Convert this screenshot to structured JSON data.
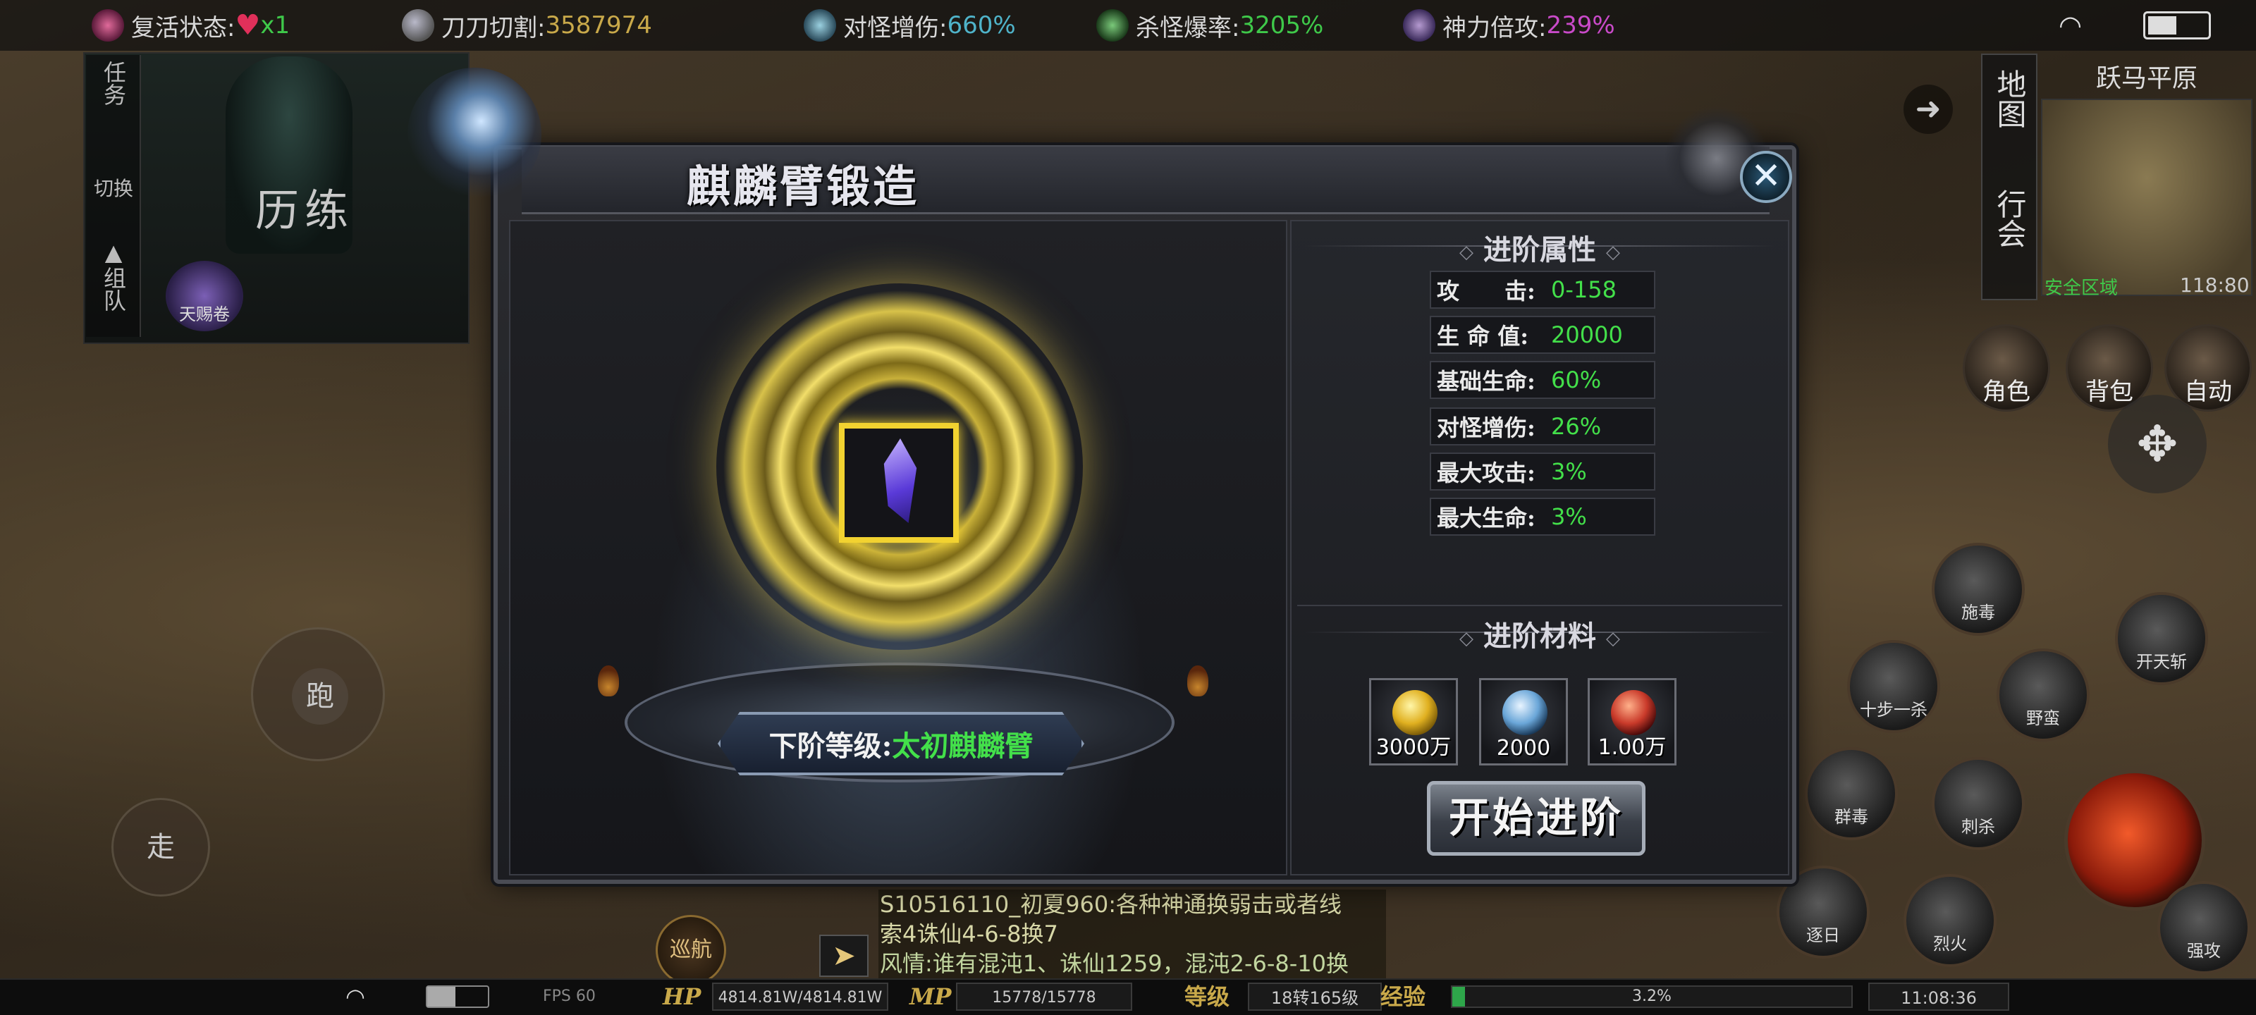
{
  "status_bar": {
    "revive": {
      "label": "复活状态:",
      "value": "x1",
      "color": "#3fc94a"
    },
    "cut": {
      "label": "刀刀切割:",
      "value": "3587974",
      "color": "#c9a94a"
    },
    "monster_damage": {
      "label": "对怪增伤:",
      "value": "660%",
      "color": "#4fb3c9"
    },
    "drop_rate": {
      "label": "杀怪爆率:",
      "value": "3205%",
      "color": "#3fc94a"
    },
    "divine_power": {
      "label": "神力倍攻:",
      "value": "239%",
      "color": "#c94ac9"
    }
  },
  "left_panel": {
    "tabs": [
      "任务",
      "切换",
      "组队"
    ],
    "title": "历练",
    "skill_label": "天赐卷"
  },
  "minimap": {
    "location": "跃马平原",
    "tabs": [
      "地图",
      "行会"
    ],
    "safe_zone": "安全区域",
    "coords": "118:80"
  },
  "right_buttons": {
    "character": "角色",
    "bag": "背包",
    "auto": "自动"
  },
  "skills": {
    "s1": "施毒",
    "s2": "开天斩",
    "s3": "十步一杀",
    "s4": "野蛮",
    "s5": "群毒",
    "s6": "刺杀",
    "s7": "逐日",
    "s8": "烈火",
    "s9": "强攻"
  },
  "joystick": {
    "run": "跑",
    "walk": "走"
  },
  "chat": {
    "lines": [
      "S10516110_初夏960:各种神通换弱击或者线",
      "索4诛仙4-6-8换7",
      "风情:谁有混沌1、诛仙1259，混沌2-6-8-10换"
    ],
    "patrol": "巡航"
  },
  "bottom_bar": {
    "fps": "FPS 60",
    "hp_label": "HP",
    "hp_value": "4814.81W/4814.81W",
    "mp_label": "MP",
    "mp_value": "15778/15778",
    "level_label": "等级",
    "level_value": "18转165级",
    "exp_label": "经验",
    "exp_value": "3.2%",
    "exp_fraction": 0.032,
    "time": "11:08:36"
  },
  "dialog": {
    "title": "麒麟臂锻造",
    "next_level_label": "下阶等级:",
    "next_level_value": "太初麒麟臂",
    "attributes_header": "进阶属性",
    "attributes": [
      {
        "key": "攻　　击:",
        "value": "0-158"
      },
      {
        "key": "生 命 值:",
        "value": "20000"
      },
      {
        "key": "基础生命:",
        "value": "60%"
      },
      {
        "key": "对怪增伤:",
        "value": "26%"
      },
      {
        "key": "最大攻击:",
        "value": "3%"
      },
      {
        "key": "最大生命:",
        "value": "3%"
      }
    ],
    "materials_header": "进阶材料",
    "materials": [
      {
        "icon": "gold-ingot-icon",
        "amount": "3000万"
      },
      {
        "icon": "blue-crystal-icon",
        "amount": "2000"
      },
      {
        "icon": "red-orb-icon",
        "amount": "1.00万"
      }
    ],
    "advance_button": "开始进阶",
    "close_icon": "close-icon"
  },
  "colors": {
    "value_green": "#43e04a",
    "slot_gold": "#f2d230"
  }
}
